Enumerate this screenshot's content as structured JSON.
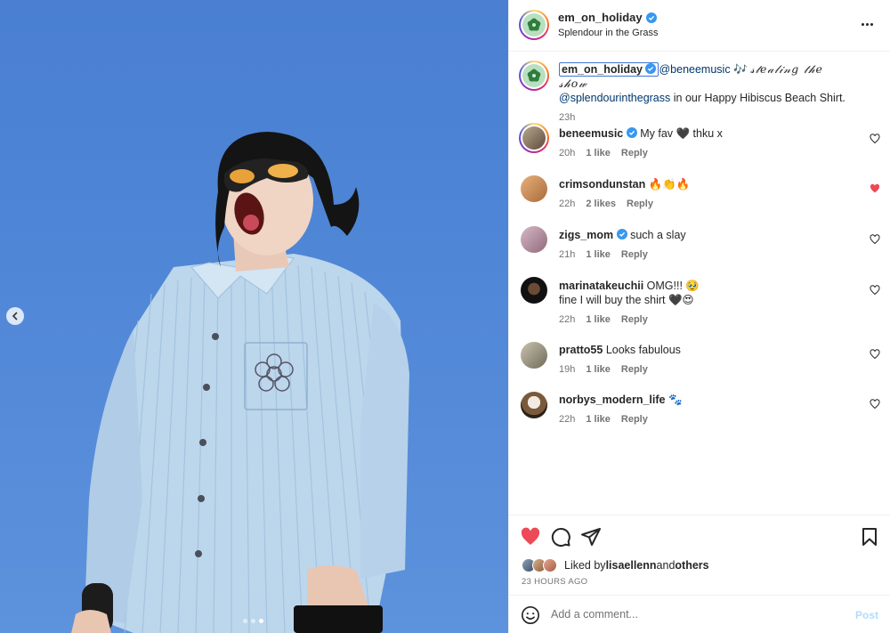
{
  "header": {
    "username": "em_on_holiday",
    "location": "Splendour in the Grass",
    "more_icon": "more-horizontal-icon"
  },
  "caption": {
    "username": "em_on_holiday",
    "mention1": "@beneemusic",
    "music_glyph": "🎶",
    "script_text": "𝓈𝓉𝑒𝒶𝓁𝒾𝓃𝑔 𝓉𝒽𝑒 𝓈𝒽𝑜𝓌",
    "mention2": "@splendourinthegrass",
    "rest": " in our Happy Hibiscus Beach Shirt.",
    "time": "23h"
  },
  "comments": [
    {
      "username": "beneemusic",
      "verified": true,
      "text": "My fav 🖤 thku x",
      "time": "20h",
      "likes": "1 like",
      "reply": "Reply",
      "liked": false
    },
    {
      "username": "crimsondunstan",
      "verified": false,
      "text": "🔥👏🔥",
      "time": "22h",
      "likes": "2 likes",
      "reply": "Reply",
      "liked": true
    },
    {
      "username": "zigs_mom",
      "verified": true,
      "text": "such a slay",
      "time": "21h",
      "likes": "1 like",
      "reply": "Reply",
      "liked": false
    },
    {
      "username": "marinatakeuchii",
      "verified": false,
      "text": "OMG!!! 🥹",
      "text2": "fine I will buy the shirt 🖤😍",
      "time": "22h",
      "likes": "1 like",
      "reply": "Reply",
      "liked": false
    },
    {
      "username": "pratto55",
      "verified": false,
      "text": "Looks fabulous",
      "time": "19h",
      "likes": "1 like",
      "reply": "Reply",
      "liked": false
    },
    {
      "username": "norbys_modern_life",
      "verified": false,
      "text": "🐾",
      "time": "22h",
      "likes": "1 like",
      "reply": "Reply",
      "liked": false
    }
  ],
  "likes": {
    "prefix": "Liked by ",
    "user": "lisaellenn",
    "middle": " and ",
    "others": "others",
    "timestamp": "23 HOURS AGO"
  },
  "composer": {
    "placeholder": "Add a comment...",
    "post_label": "Post"
  },
  "colors": {
    "like_red": "#ed4956",
    "link_blue": "#00376b",
    "verified_blue": "#3897f0",
    "post_disabled": "#b3dbff"
  },
  "carousel": {
    "current": 3,
    "total": 3
  }
}
